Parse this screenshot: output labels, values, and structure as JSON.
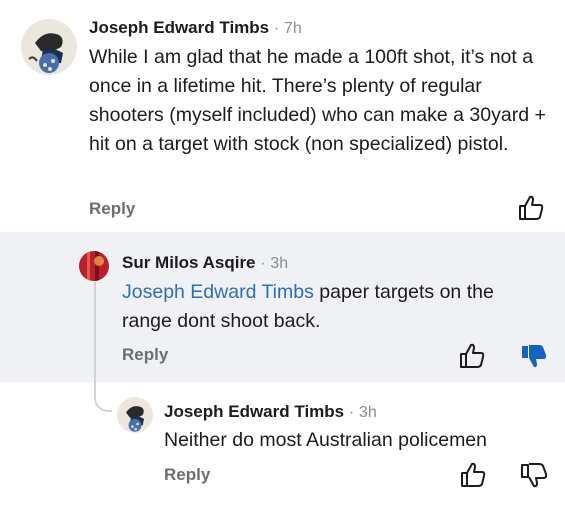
{
  "comments": [
    {
      "author": "Joseph Edward Timbs",
      "separator": "·",
      "time": "7h",
      "text": "While I am glad that he made a 100ft shot, it’s not a once in a lifetime hit. There’s plenty of regular shooters (myself included) who can make a 30yard + hit on a target with stock (non specialized) pistol.",
      "reply_label": "Reply",
      "avatar_icon": "ukiyo-e-avatar",
      "actions": [
        "thumbs-up-icon"
      ]
    },
    {
      "author": "Sur Milos Asqire",
      "separator": "·",
      "time": "3h",
      "mention": "Joseph Edward Timbs",
      "text": " paper targets on the range dont shoot back.",
      "reply_label": "Reply",
      "avatar_icon": "red-abstract-avatar",
      "actions": [
        "thumbs-up-icon",
        "thumbs-down-icon-filled"
      ],
      "downvote_color": "#1565c0"
    },
    {
      "author": "Joseph Edward Timbs",
      "separator": "·",
      "time": "3h",
      "text": "Neither do most Australian policemen",
      "reply_label": "Reply",
      "avatar_icon": "ukiyo-e-avatar",
      "actions": [
        "thumbs-up-icon",
        "thumbs-down-icon"
      ]
    }
  ],
  "colors": {
    "highlight_background": "#eff1f4",
    "mention": "#2f6db5",
    "meta": "#8a8d91"
  }
}
